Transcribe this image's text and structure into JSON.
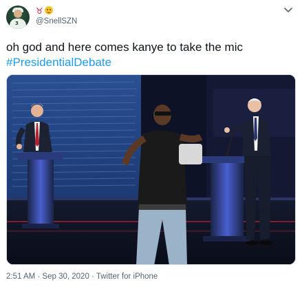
{
  "header": {
    "avatar_icon": "avatar-image",
    "emojis": [
      "bull-emoji",
      "smiling-face-emoji"
    ],
    "handle": "@SnellSZN",
    "menu_icon": "chevron-down-icon"
  },
  "tweet": {
    "text": "oh god and here comes kanye to take the mic",
    "hashtag": "#PresidentialDebate",
    "hashtag_color": "#1d9bf0"
  },
  "media": {
    "description_icon": "debate-meme-image"
  },
  "meta": {
    "timestamp": "2:51 AM · Sep 30, 2020 · Twitter for iPhone"
  }
}
